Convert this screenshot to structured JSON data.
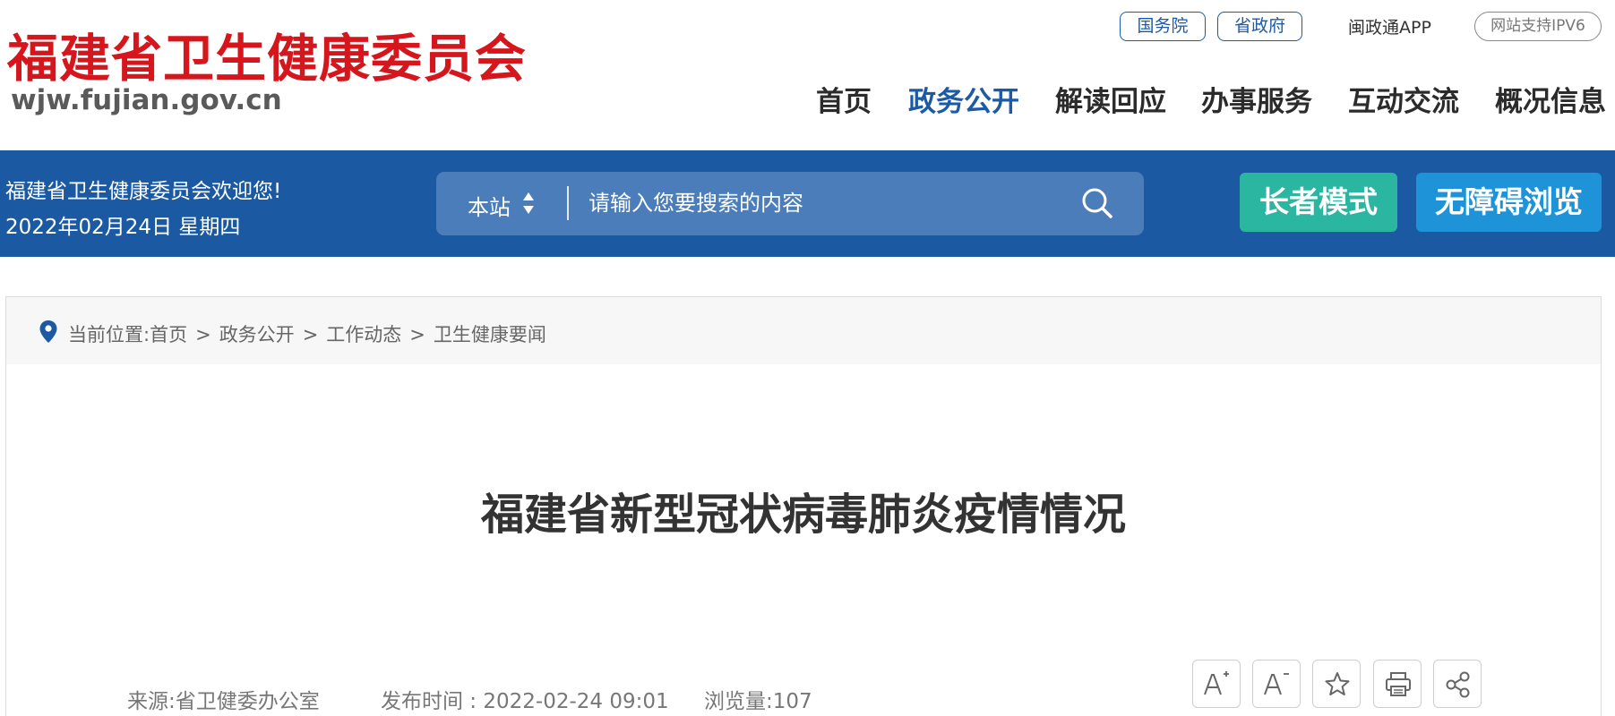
{
  "header": {
    "logo_cn": "福建省卫生健康委员会",
    "logo_url": "wjw.fujian.gov.cn",
    "top_links": {
      "guowuyuan": "国务院",
      "shengzhengfu": "省政府",
      "app": "闽政通APP",
      "ipv6": "网站支持IPV6"
    },
    "nav": {
      "home": "首页",
      "gov_affairs": "政务公开",
      "interpretation": "解读回应",
      "services": "办事服务",
      "interaction": "互动交流",
      "overview": "概况信息",
      "active": "gov_affairs"
    }
  },
  "bluebar": {
    "welcome": "福建省卫生健康委员会欢迎您!",
    "date": "2022年02月24日 星期四",
    "search": {
      "scope": "本站",
      "placeholder": "请输入您要搜索的内容"
    },
    "elder_mode": "长者模式",
    "barrier_free": "无障碍浏览"
  },
  "breadcrumb": {
    "prefix": "当前位置:",
    "items": [
      "首页",
      "政务公开",
      "工作动态",
      "卫生健康要闻"
    ],
    "separator": ">"
  },
  "article": {
    "title": "福建省新型冠状病毒肺炎疫情情况",
    "source": "来源:省卫健委办公室",
    "publish_time": "发布时间 : 2022-02-24 09:01",
    "views": "浏览量:107"
  },
  "tools": [
    {
      "name": "font-increase",
      "icon": "a-plus-icon"
    },
    {
      "name": "font-decrease",
      "icon": "a-minus-icon"
    },
    {
      "name": "favorite",
      "icon": "star-icon"
    },
    {
      "name": "print",
      "icon": "print-icon"
    },
    {
      "name": "share",
      "icon": "share-icon"
    }
  ],
  "colors": {
    "logo_red": "#d5161d",
    "brand_blue": "#1b5aa3",
    "search_bg": "#4a7db9",
    "elder_button": "#2bb6a2",
    "barrier_button": "#1f93d8"
  }
}
